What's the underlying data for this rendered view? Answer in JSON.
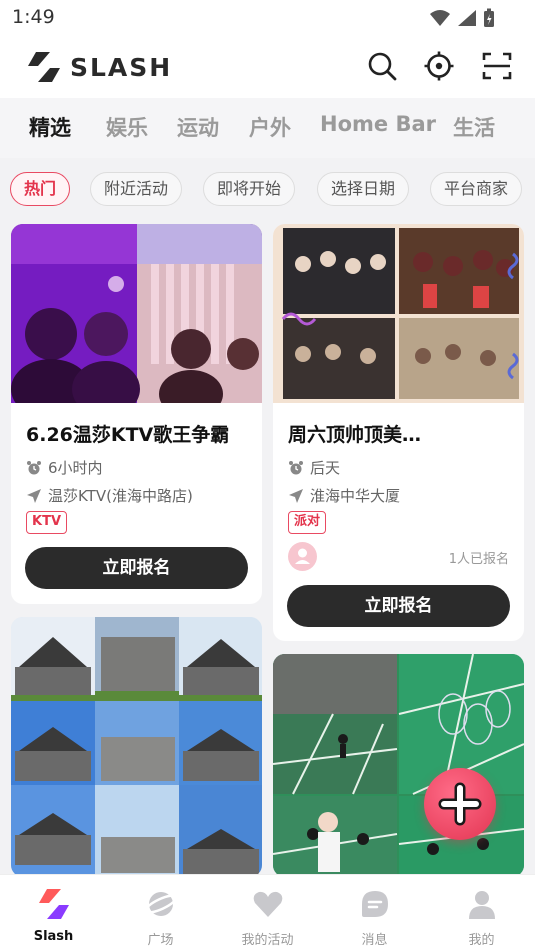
{
  "status_bar": {
    "time": "1:49"
  },
  "header": {
    "brand": "SLASH"
  },
  "categories": [
    {
      "label": "精选",
      "active": true
    },
    {
      "label": "娱乐"
    },
    {
      "label": "运动"
    },
    {
      "label": "户外"
    },
    {
      "label": "Home Bar"
    },
    {
      "label": "生活"
    }
  ],
  "filters": [
    {
      "label": "热门",
      "active": true
    },
    {
      "label": "附近活动"
    },
    {
      "label": "即将开始"
    },
    {
      "label": "选择日期"
    },
    {
      "label": "平台商家"
    }
  ],
  "cards": [
    {
      "title": "6.26温莎KTV歌王争霸",
      "time": "6小时内",
      "location": "温莎KTV(淮海中路店)",
      "tag": "KTV",
      "button": "立即报名"
    },
    {
      "title": "周六顶帅顶美…",
      "time": "后天",
      "location": "淮海中华大厦",
      "tag": "派对",
      "signup_count": "1人已报名",
      "button": "立即报名"
    }
  ],
  "colors": {
    "accent": "#e3344c",
    "button": "#2b2b2b",
    "background": "#f2f2f4"
  },
  "bottom_nav": [
    {
      "label": "Slash",
      "icon": "slash-logo-icon",
      "active": true
    },
    {
      "label": "广场",
      "icon": "planet-icon"
    },
    {
      "label": "我的活动",
      "icon": "heart-icon"
    },
    {
      "label": "消息",
      "icon": "message-icon"
    },
    {
      "label": "我的",
      "icon": "person-icon"
    }
  ]
}
